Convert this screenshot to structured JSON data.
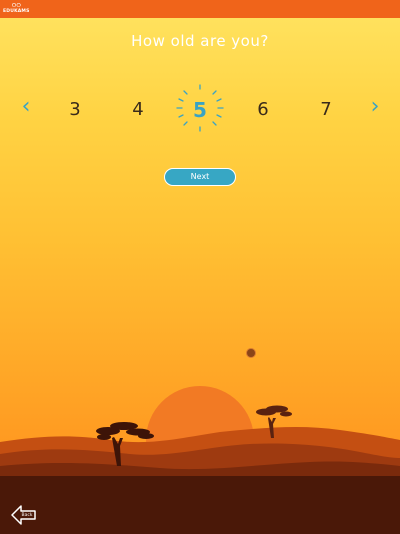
{
  "header": {
    "logo_text": "EDUKAMS",
    "logo_icon": "owl-icon",
    "bar_color": "#f0641a"
  },
  "question": {
    "title": "How old are you?"
  },
  "age_picker": {
    "ages": [
      "3",
      "4",
      "5",
      "6",
      "7"
    ],
    "selected": "5",
    "prev_icon": "chevron-left-icon",
    "next_icon": "chevron-right-icon",
    "accent_color": "#3aa3c4"
  },
  "actions": {
    "next_label": "Next",
    "back_label": "Back"
  }
}
